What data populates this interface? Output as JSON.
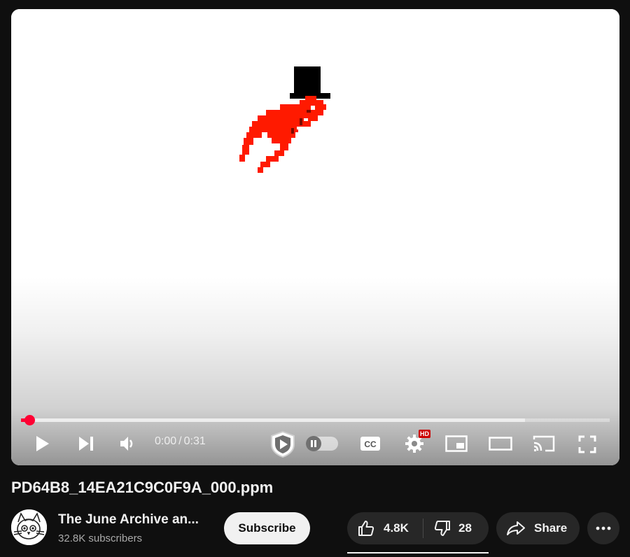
{
  "video": {
    "current_time": "0:00",
    "separator": "/",
    "duration": "0:31",
    "played_fraction": 0.014,
    "buffered_fraction": 0.856,
    "settings_badge": "HD",
    "title": "PD64B8_14EA21C9C0F9A_000.ppm"
  },
  "channel": {
    "name": "The June Archive an...",
    "subscribers": "32.8K subscribers",
    "subscribe_label": "Subscribe"
  },
  "actions": {
    "like_count": "4.8K",
    "dislike_count": "28",
    "share_label": "Share"
  },
  "colors": {
    "accent": "#ff0033",
    "background": "#0f0f0f",
    "pill": "#272727",
    "sprite_red": "#ff1a00"
  },
  "icons": {
    "play": "play-icon",
    "next": "next-icon",
    "volume": "volume-icon",
    "shield": "shield-play-icon",
    "autoplay": "autoplay-toggle",
    "captions": "cc-icon",
    "settings": "gear-icon",
    "miniplayer": "miniplayer-icon",
    "theater": "theater-icon",
    "cast": "cast-icon",
    "fullscreen": "fullscreen-icon",
    "like": "thumbs-up-icon",
    "dislike": "thumbs-down-icon",
    "share": "share-arrow-icon",
    "more": "more-dots-icon"
  }
}
